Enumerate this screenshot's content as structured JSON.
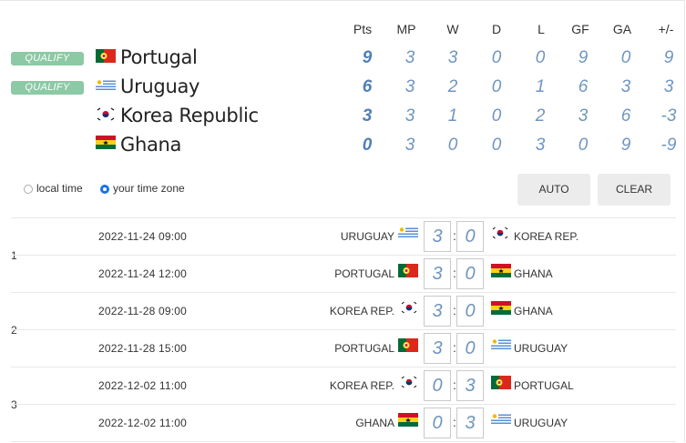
{
  "standings": {
    "headers": [
      "Pts",
      "MP",
      "W",
      "D",
      "L",
      "GF",
      "GA",
      "+/-"
    ],
    "rows": [
      {
        "badge": "QUALIFY",
        "flag": "portugal-flag",
        "team": "Portugal",
        "stats": [
          "9",
          "3",
          "3",
          "0",
          "0",
          "9",
          "0",
          "9"
        ]
      },
      {
        "badge": "QUALIFY",
        "flag": "uruguay-flag",
        "team": "Uruguay",
        "stats": [
          "6",
          "3",
          "2",
          "0",
          "1",
          "6",
          "3",
          "3"
        ]
      },
      {
        "badge": "",
        "flag": "korea-flag",
        "team": "Korea Republic",
        "stats": [
          "3",
          "3",
          "1",
          "0",
          "2",
          "3",
          "6",
          "-3"
        ]
      },
      {
        "badge": "",
        "flag": "ghana-flag",
        "team": "Ghana",
        "stats": [
          "0",
          "3",
          "0",
          "0",
          "3",
          "0",
          "9",
          "-9"
        ]
      }
    ]
  },
  "timezone": {
    "local_label": "local time",
    "yours_label": "your time zone",
    "selected": "yours"
  },
  "buttons": {
    "auto": "AUTO",
    "clear": "CLEAR"
  },
  "rounds": [
    {
      "label": "1",
      "matches": [
        {
          "date": "2022-11-24  09:00",
          "home": "URUGUAY",
          "home_flag": "uruguay-flag",
          "home_score": "3",
          "away_score": "0",
          "away": "KOREA REP.",
          "away_flag": "korea-flag"
        },
        {
          "date": "2022-11-24  12:00",
          "home": "PORTUGAL",
          "home_flag": "portugal-flag",
          "home_score": "3",
          "away_score": "0",
          "away": "GHANA",
          "away_flag": "ghana-flag"
        }
      ]
    },
    {
      "label": "2",
      "matches": [
        {
          "date": "2022-11-28  09:00",
          "home": "KOREA REP.",
          "home_flag": "korea-flag",
          "home_score": "3",
          "away_score": "0",
          "away": "GHANA",
          "away_flag": "ghana-flag"
        },
        {
          "date": "2022-11-28  15:00",
          "home": "PORTUGAL",
          "home_flag": "portugal-flag",
          "home_score": "3",
          "away_score": "0",
          "away": "URUGUAY",
          "away_flag": "uruguay-flag"
        }
      ]
    },
    {
      "label": "3",
      "matches": [
        {
          "date": "2022-12-02  11:00",
          "home": "KOREA REP.",
          "home_flag": "korea-flag",
          "home_score": "0",
          "away_score": "3",
          "away": "PORTUGAL",
          "away_flag": "portugal-flag"
        },
        {
          "date": "2022-12-02  11:00",
          "home": "GHANA",
          "home_flag": "ghana-flag",
          "home_score": "0",
          "away_score": "3",
          "away": "URUGUAY",
          "away_flag": "uruguay-flag"
        }
      ]
    }
  ],
  "colors": {
    "badge": "#8cc9a5",
    "stat": "#6f95c0",
    "pts": "#4f7fb8",
    "radio_selected": "#1a73e8",
    "button_bg": "#ececec"
  }
}
